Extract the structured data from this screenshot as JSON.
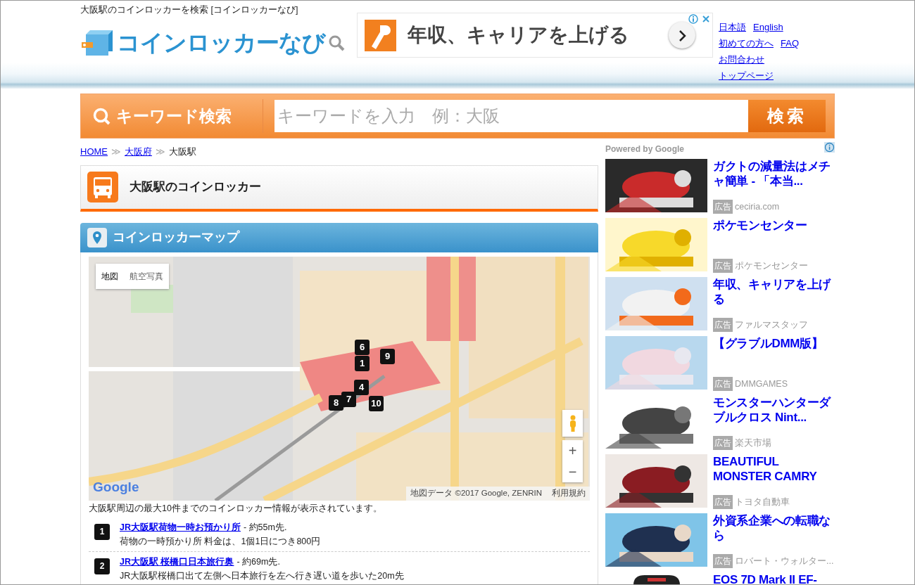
{
  "page_tagline": "大阪駅のコインロッカーを検索 [コインロッカーなび]",
  "logo": {
    "text": "コインロッカーなび"
  },
  "banner_ad": {
    "text": "年収、キャリアを上げる"
  },
  "header_links": [
    {
      "links": [
        "日本語",
        "English"
      ]
    },
    {
      "links": [
        "初めての方へ",
        "FAQ"
      ]
    },
    {
      "links": [
        "お問合わせ"
      ]
    },
    {
      "links": [
        "トップページ"
      ]
    }
  ],
  "search": {
    "label": "キーワード検索",
    "placeholder": "キーワードを入力　例：大阪",
    "button": "検索"
  },
  "breadcrumb": [
    {
      "label": "HOME",
      "link": true
    },
    {
      "separator": "≫",
      "label": "大阪府",
      "link": true
    },
    {
      "separator": "≫",
      "label": "大阪駅",
      "link": false
    }
  ],
  "page_title": "大阪駅のコインロッカー",
  "map_section": {
    "title": "コインロッカーマップ",
    "map_types": [
      {
        "label": "地図",
        "selected": true
      },
      {
        "label": "航空写真",
        "selected": false
      }
    ],
    "markers": [
      "6",
      "1",
      "9",
      "4",
      "8",
      "7",
      "10"
    ],
    "zoom_in": "+",
    "zoom_out": "−",
    "logo": "Google",
    "attribution": "地図データ ©2017 Google, ZENRIN",
    "terms": "利用規約",
    "caption": "大阪駅周辺の最大10件までのコインロッカー情報が表示されています。",
    "lockers": [
      {
        "number": "1",
        "name": "JR大阪駅荷物一時お預かり所",
        "distance": "- 約55m先.",
        "description": "荷物の一時預かり所 料金は、1個1日につき800円"
      },
      {
        "number": "2",
        "name": "JR大阪駅 桜橋口日本旅行奥",
        "distance": "- 約69m先.",
        "description": "JR大阪駅桜橋口出て左側へ日本旅行を左へ行き遅い道を歩いた20m先"
      }
    ]
  },
  "sidebar": {
    "powered_by": "Powered by Google",
    "ads": [
      {
        "title": "ガクトの減量法はメチャ簡単 - 「本当...",
        "badge": "広告",
        "source": "ceciria.com"
      },
      {
        "title": "ポケモンセンター",
        "badge": "広告",
        "source": "ポケモンセンター"
      },
      {
        "title": "年収、キャリアを上げる",
        "badge": "広告",
        "source": "ファルマスタッフ"
      },
      {
        "title": "【グラブルDMM版】",
        "badge": "広告",
        "source": "DMMGAMES"
      },
      {
        "title": "モンスターハンターダブルクロス Nint...",
        "badge": "広告",
        "source": "楽天市場"
      },
      {
        "title": "BEAUTIFUL MONSTER CAMRY",
        "badge": "広告",
        "source": "トヨタ自動車"
      },
      {
        "title": "外資系企業への転職なら",
        "badge": "広告",
        "source": "ロバート・ウォルター..."
      },
      {
        "title": "EOS 7D Mark II EF-"
      }
    ]
  }
}
